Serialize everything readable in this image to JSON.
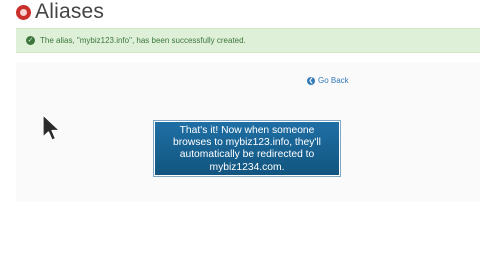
{
  "header": {
    "title": "Aliases"
  },
  "alert": {
    "message": "The alias, \"mybiz123.info\", has been successfully created."
  },
  "actions": {
    "go_back_label": "Go Back"
  },
  "callout": {
    "lines": [
      "That's it! Now when someone",
      "browses to mybiz123.info, they'll",
      "automatically be redirected to",
      "mybiz1234.com."
    ]
  },
  "icons": {
    "logo": "app-logo-icon",
    "alert": "check-circle-icon",
    "back": "arrow-circle-left-icon",
    "cursor": "mouse-pointer-icon"
  },
  "colors": {
    "alert_background": "#dff0d8",
    "alert_text": "#3c763d",
    "link": "#337ab7",
    "callout_background": "#1a6496",
    "logo": "#c9302c"
  }
}
